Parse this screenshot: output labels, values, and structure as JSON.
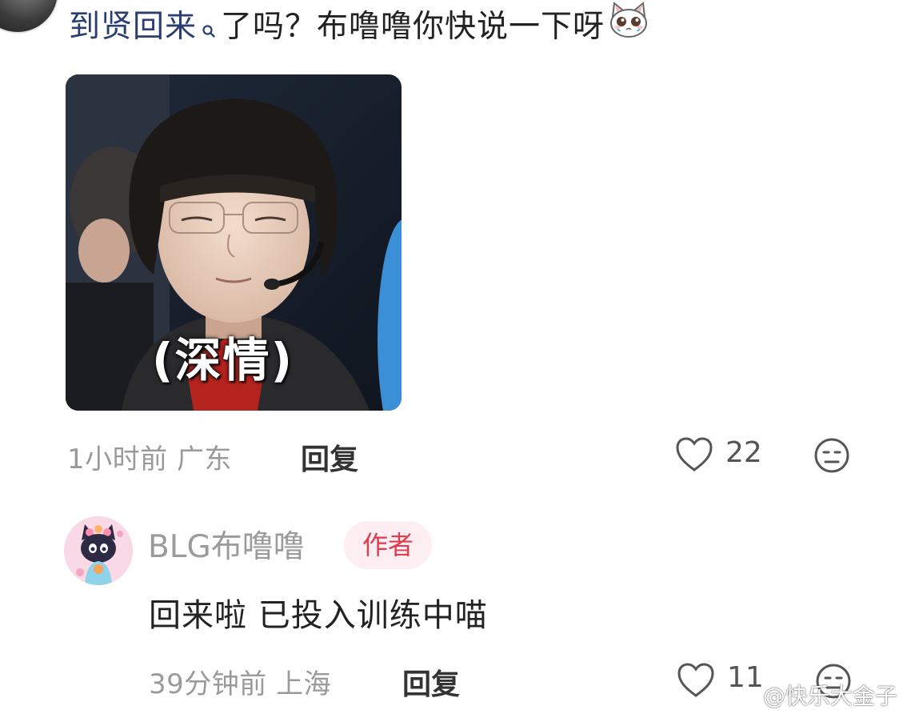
{
  "top_comment": {
    "link_text": "到贤回来",
    "text": "了吗？布噜噜你快说一下呀",
    "emoji": "crying-cat-emoji",
    "image_caption": "(深情)",
    "time": "1小时前",
    "location": "广东",
    "reply_label": "回复",
    "like_count": "22"
  },
  "reply": {
    "username": "BLG布噜噜",
    "badge": "作者",
    "text": "回来啦 已投入训练中喵",
    "time": "39分钟前",
    "location": "上海",
    "reply_label": "回复",
    "like_count": "11"
  },
  "watermark": "@快乐大金子",
  "colors": {
    "link": "#2b3e72",
    "badge_text": "#e33a4e",
    "badge_bg": "#fdeff1",
    "meta_gray": "#9a9a9a"
  }
}
